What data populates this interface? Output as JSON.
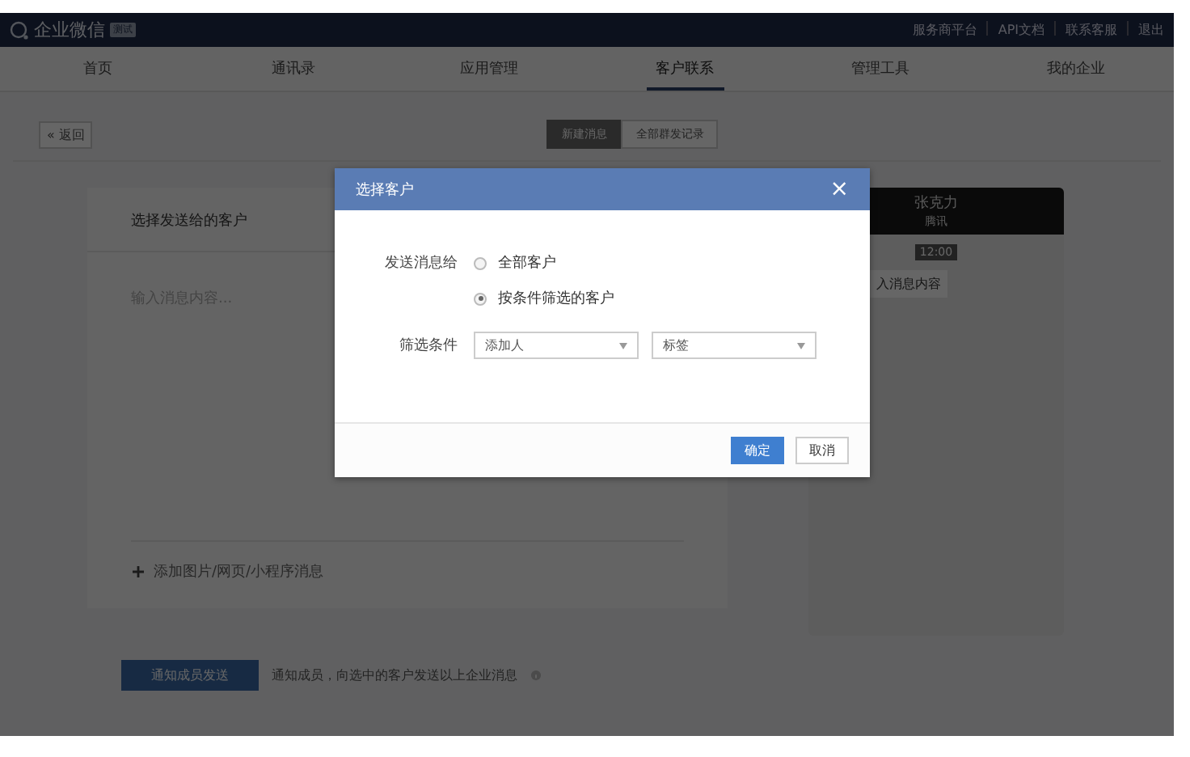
{
  "top_bar": {
    "logo_text": "企业微信",
    "badge": "测试",
    "links": [
      "服务商平台",
      "API文档",
      "联系客服",
      "退出"
    ]
  },
  "nav": {
    "tabs": [
      {
        "label": "首页",
        "selected": false
      },
      {
        "label": "通讯录",
        "selected": false
      },
      {
        "label": "应用管理",
        "selected": false
      },
      {
        "label": "客户联系",
        "selected": true
      },
      {
        "label": "管理工具",
        "selected": false
      },
      {
        "label": "我的企业",
        "selected": false
      }
    ]
  },
  "toolbar": {
    "back_button": "« 返回",
    "segments": [
      {
        "label": "新建消息",
        "selected": true
      },
      {
        "label": "全部群发记录",
        "selected": false
      }
    ]
  },
  "editor": {
    "recipient_label": "选择发送给的客户",
    "message_placeholder": "输入消息内容...",
    "add_attachment": "添加图片/网页/小程序消息"
  },
  "footer": {
    "send_button": "通知成员发送",
    "note": "通知成员，向选中的客户发送以上企业消息"
  },
  "preview": {
    "name": "张克力",
    "company": "腾讯",
    "time": "12:00",
    "bubble": "入消息内容"
  },
  "dialog": {
    "title": "选择客户",
    "close": "×",
    "send_to_label": "发送消息给",
    "options": [
      {
        "label": "全部客户",
        "selected": false
      },
      {
        "label": "按条件筛选的客户",
        "selected": true
      }
    ],
    "filter_label": "筛选条件",
    "filters": [
      {
        "value": "添加人"
      },
      {
        "value": "标签"
      }
    ],
    "buttons": [
      {
        "label": "确定",
        "kind": "primary"
      },
      {
        "label": "取消",
        "kind": "secondary"
      }
    ]
  }
}
